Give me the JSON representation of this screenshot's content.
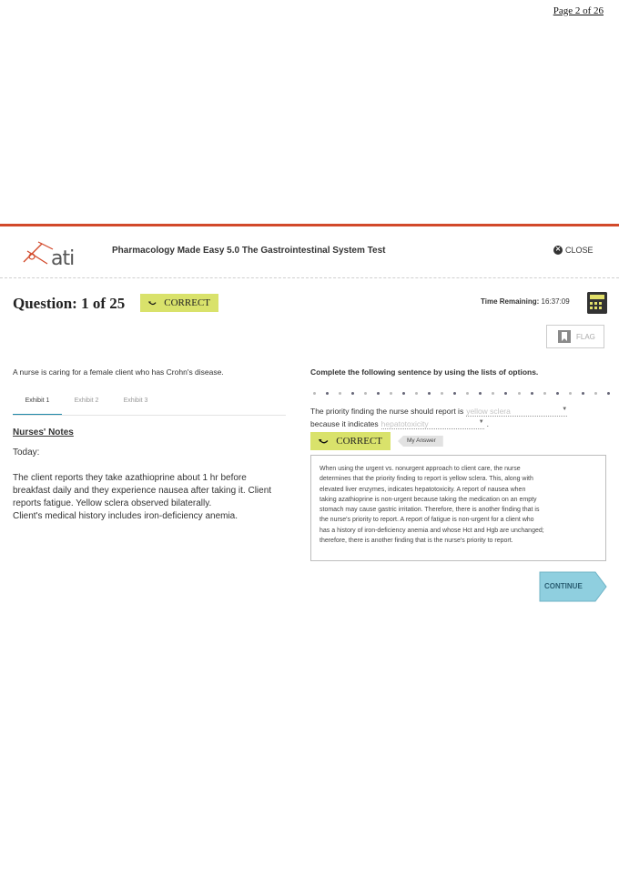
{
  "page_number": "Page 2 of 26",
  "header": {
    "logo_text": "ati",
    "test_title": "Pharmacology Made Easy 5.0 The Gastrointestinal System Test",
    "close_label": "CLOSE"
  },
  "question": {
    "label": "Question: 1 of 25",
    "status": "CORRECT",
    "time_label": "Time Remaining:",
    "time_value": "16:37:09",
    "flag_label": "FLAG"
  },
  "left": {
    "stem": "A nurse is caring for a female client who has Crohn's disease.",
    "tabs": [
      "Exhibit 1",
      "Exhibit 2",
      "Exhibit 3"
    ],
    "notes_heading": "Nurses' Notes",
    "today": "Today:",
    "notes_lines": [
      "The client reports they take azathioprine about 1 hr before",
      "breakfast daily and they experience nausea after taking it. Client",
      "reports fatigue. Yellow sclera observed bilaterally.",
      "Client's medical history includes iron-deficiency anemia."
    ]
  },
  "right": {
    "instruction": "Complete the following sentence by using the lists of options.",
    "sentence_part1": "The priority finding the nurse should report is",
    "option1": "yellow sclera",
    "sentence_part2": "because it indicates",
    "option2": "hepatotoxicity",
    "sentence_end": ".",
    "status": "CORRECT",
    "my_answer_label": "My Answer",
    "rationale_lines": [
      "When using the urgent vs. nonurgent approach to client care, the nurse",
      "determines that the priority finding to report is yellow sclera. This, along with",
      "elevated liver enzymes, indicates hepatotoxicity. A report of nausea when",
      "taking azathioprine is non-urgent because taking the medication on an empty",
      "stomach may cause gastric irritation. Therefore, there is another finding that is",
      "the nurse's priority to report. A report of fatigue is non-urgent for a client who",
      "has a history of iron-deficiency anemia and whose Hct and Hgb are unchanged;",
      "therefore, there is another finding that is the nurse's priority to report."
    ],
    "continue_label": "CONTINUE"
  },
  "colors": {
    "accent_bar": "#d2492a",
    "correct_badge": "#d9e26b",
    "continue_button": "#8fcfdf",
    "active_tab": "#1e88a8"
  }
}
